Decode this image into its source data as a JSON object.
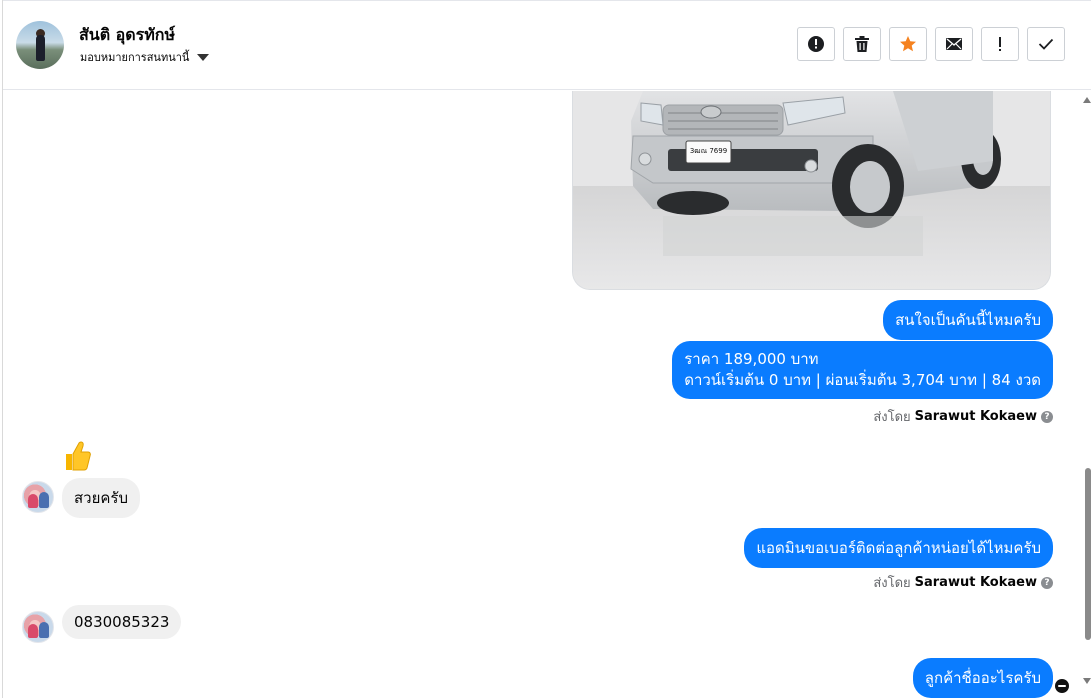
{
  "header": {
    "name": "สันติ อุดรทักษ์",
    "assign_label": "มอบหมายการสนทนานี้"
  },
  "toolbar": {
    "buttons": [
      "alert-circle-icon",
      "trash-icon",
      "star-icon",
      "envelope-icon",
      "exclamation-icon",
      "check-icon"
    ],
    "star_color": "#f5821f"
  },
  "car_image": {
    "plate": "3ฒณ 7699"
  },
  "messages": {
    "out1": "สนใจเป็นคันนี้ไหมครับ",
    "out2_line1": "ราคา 189,000 บาท",
    "out2_line2": "ดาวน์เริ่มต้น 0 บาท | ผ่อนเริ่มต้น 3,704 บาท | 84 งวด",
    "sent_by_prefix": "ส่งโดย",
    "sent_by_name": "Sarawut Kokaew",
    "in_thumbs": "👍",
    "in1": "สวยครับ",
    "out3": "แอดมินขอเบอร์ติดต่อลูกค้าหน่อยได้ไหมครับ",
    "in2": "0830085323",
    "out4": "ลูกค้าชื่ออะไรครับ"
  },
  "colors": {
    "outgoing_bubble": "#0a7cff",
    "incoming_bubble": "#f0f0f0"
  }
}
